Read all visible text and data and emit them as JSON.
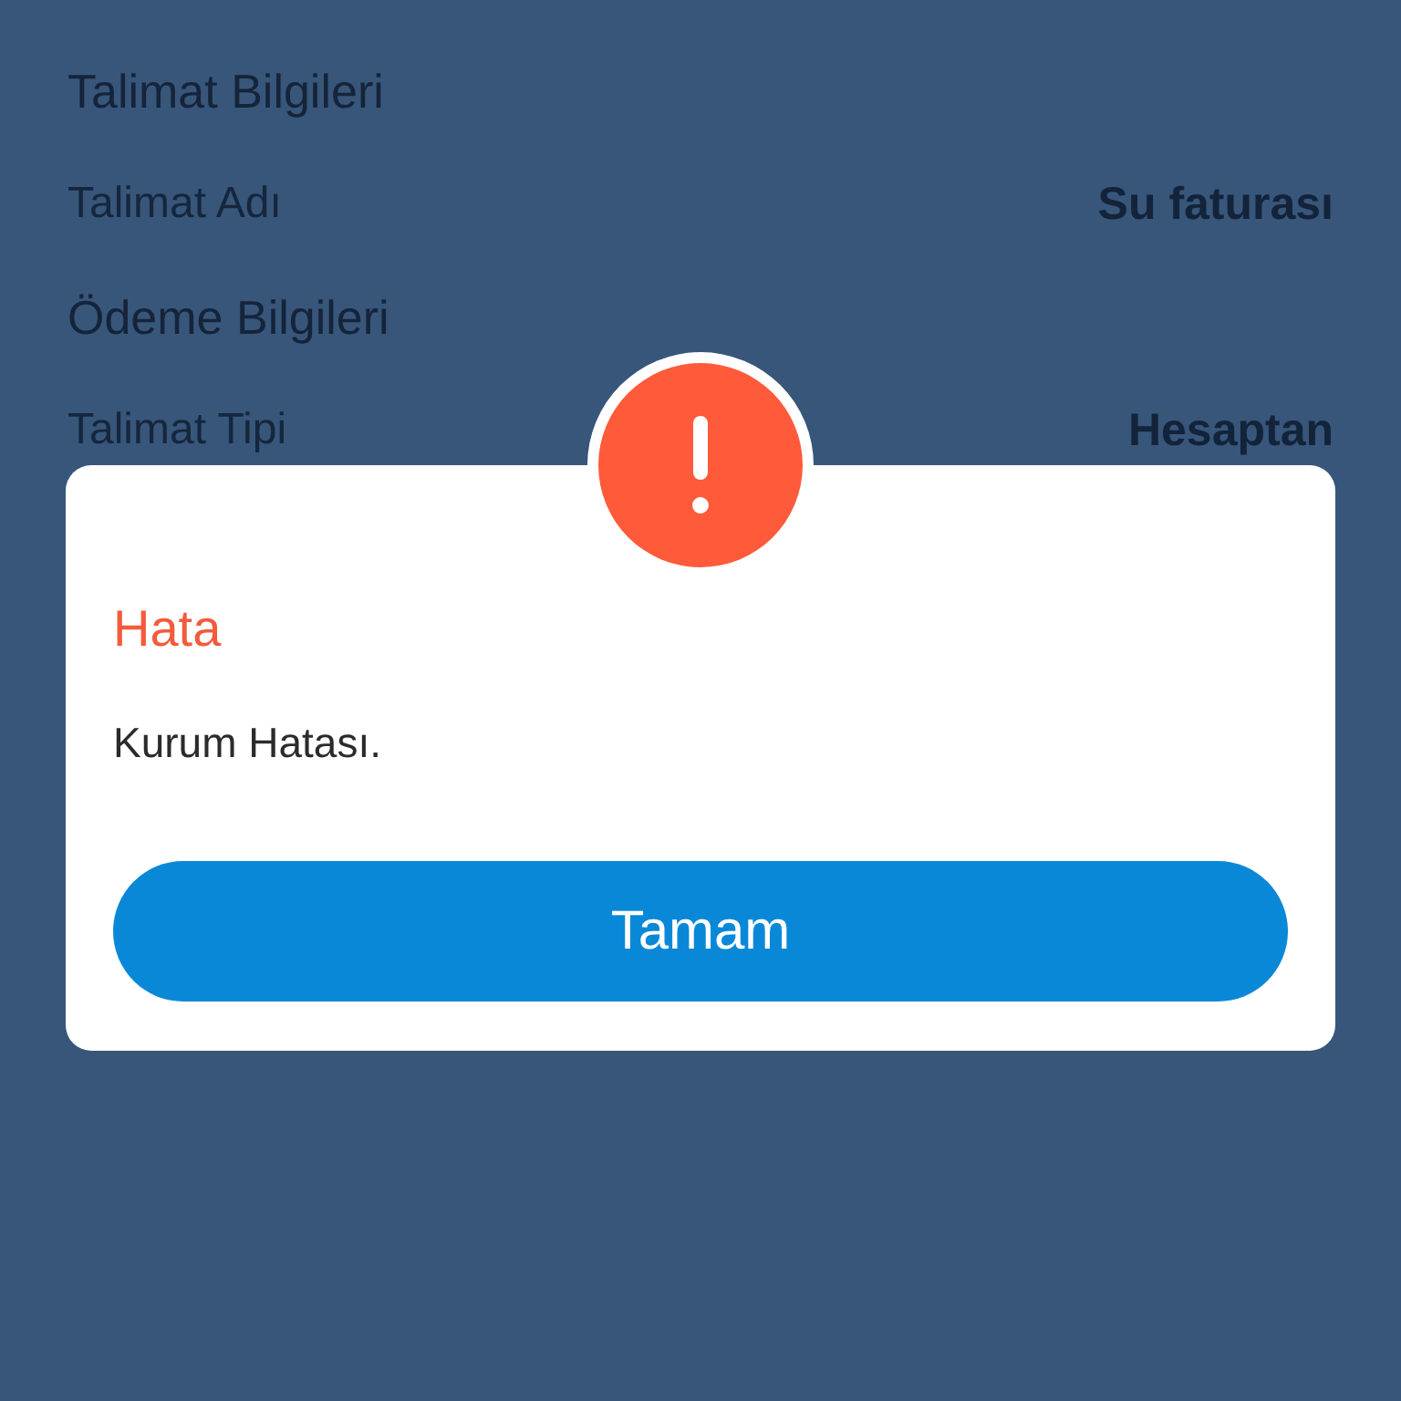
{
  "sections": [
    {
      "title": "Talimat Bilgileri",
      "rows": [
        {
          "label": "Talimat Adı",
          "value": "Su faturası"
        }
      ]
    },
    {
      "title": "Ödeme Bilgileri",
      "rows": [
        {
          "label": "Talimat Tipi",
          "value": "Hesaptan"
        }
      ]
    }
  ],
  "dialog": {
    "title": "Hata",
    "message": "Kurum Hatası.",
    "buttons": [
      "Tamam"
    ]
  }
}
